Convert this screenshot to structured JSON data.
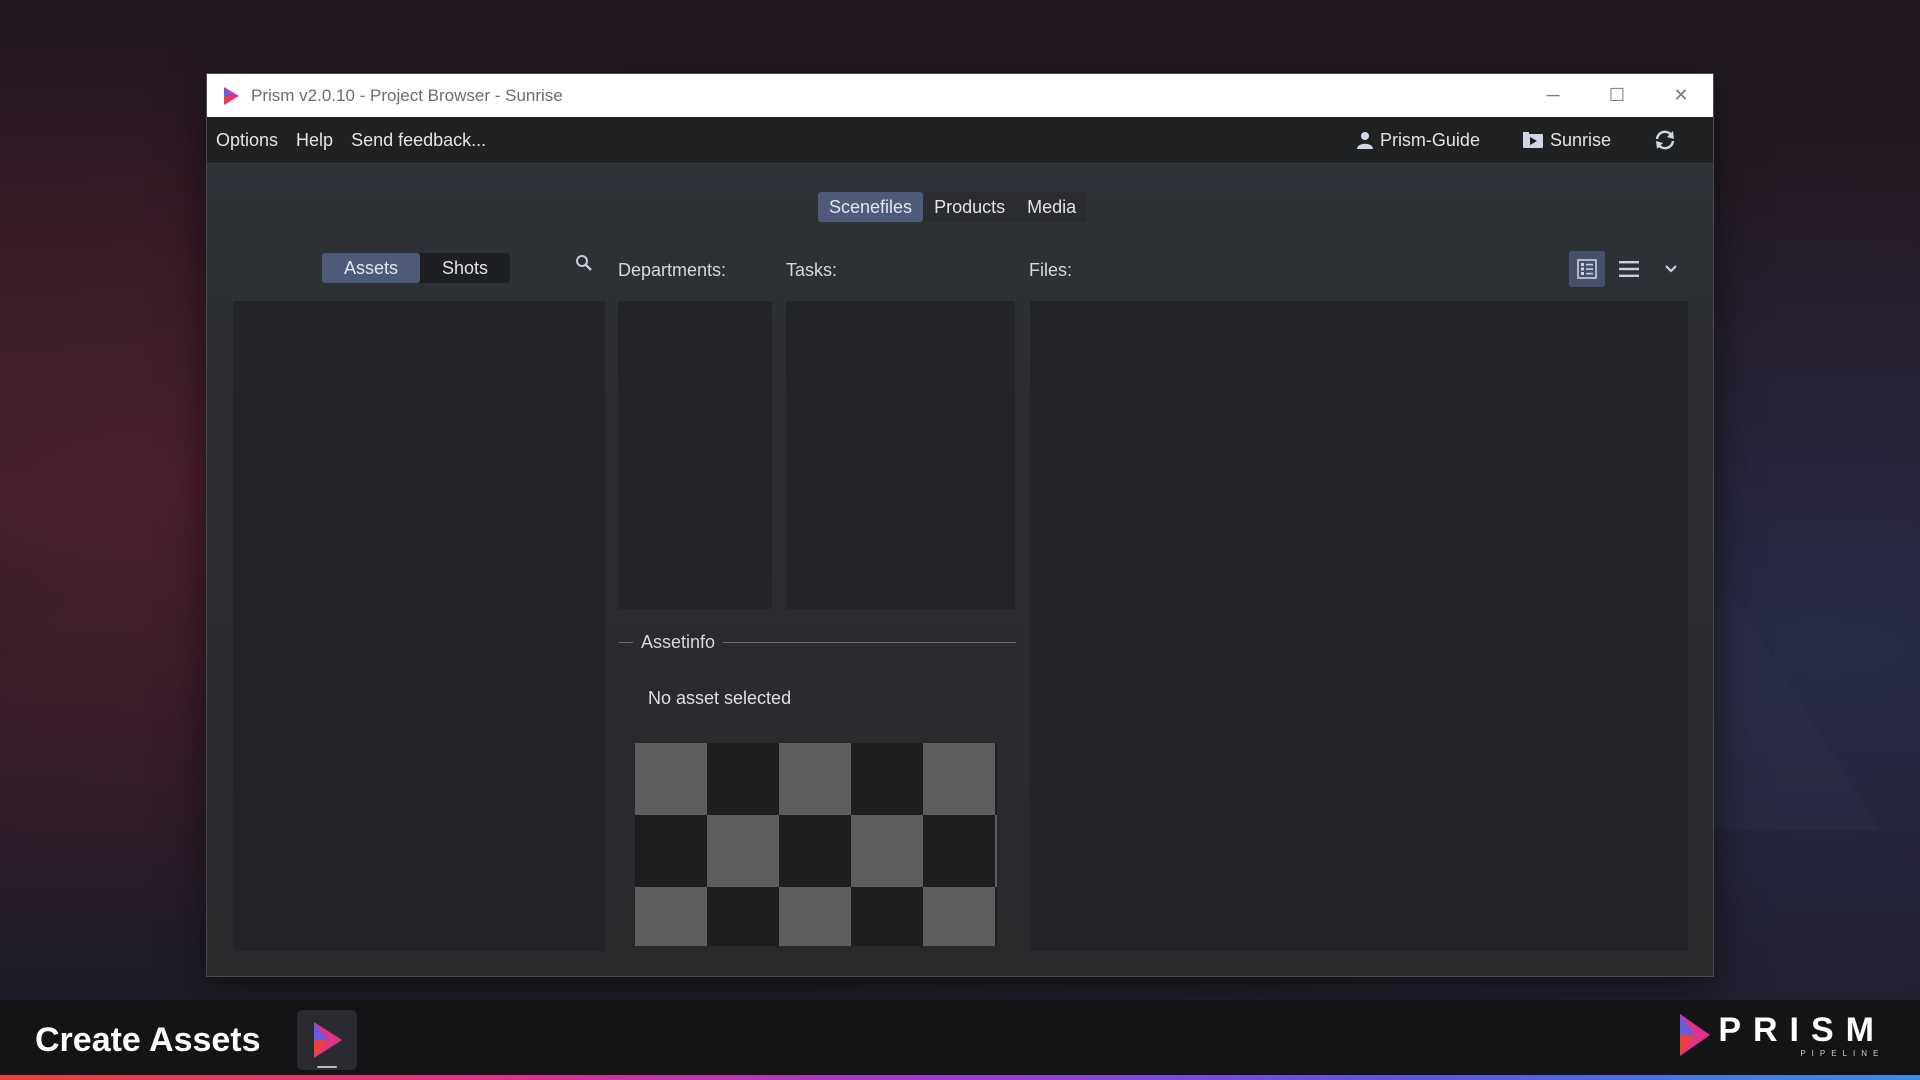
{
  "window": {
    "title": "Prism v2.0.10 - Project Browser - Sunrise",
    "controls": {
      "minimize": "─",
      "maximize": "☐",
      "close": "✕"
    }
  },
  "menubar": {
    "items": [
      "Options",
      "Help",
      "Send feedback..."
    ],
    "user": "Prism-Guide",
    "project": "Sunrise",
    "refresh_icon": "refresh-icon"
  },
  "main_tabs": [
    {
      "label": "Scenefiles",
      "active": true
    },
    {
      "label": "Products",
      "active": false
    },
    {
      "label": "Media",
      "active": false
    }
  ],
  "entity_tabs": [
    {
      "label": "Assets",
      "active": true
    },
    {
      "label": "Shots",
      "active": false
    }
  ],
  "labels": {
    "departments": "Departments:",
    "tasks": "Tasks:",
    "files": "Files:"
  },
  "view_modes": {
    "selected": "detail-list"
  },
  "assetinfo": {
    "title": "Assetinfo",
    "message": "No asset selected"
  },
  "bottom_bar": {
    "episode_title": "Create Assets",
    "brand_name": "PRISM",
    "brand_sub": "PIPELINE"
  },
  "colors": {
    "accent": "#4e5b78",
    "window_bg": "#2b2d31",
    "panel_bg": "#232427",
    "menubar_bg": "#202123"
  }
}
